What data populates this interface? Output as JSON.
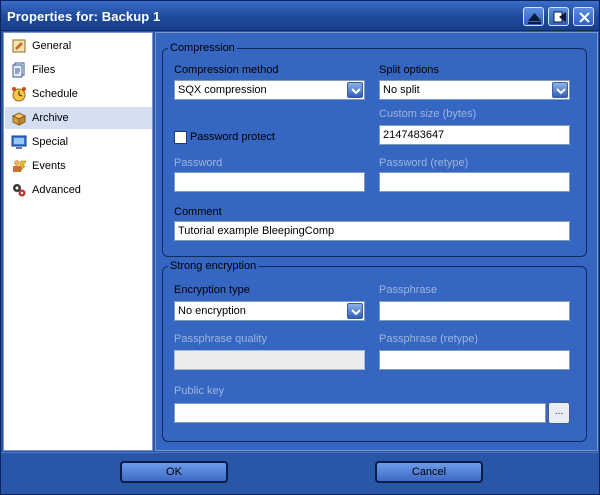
{
  "window": {
    "title": "Properties for: Backup 1"
  },
  "titlebar_buttons": [
    {
      "icon": "triangle-up-icon"
    },
    {
      "icon": "pin-icon"
    },
    {
      "icon": "close-icon"
    }
  ],
  "sidebar": {
    "selected": "Archive",
    "items": [
      {
        "label": "General",
        "icon": "general-icon"
      },
      {
        "label": "Files",
        "icon": "files-icon"
      },
      {
        "label": "Schedule",
        "icon": "schedule-icon"
      },
      {
        "label": "Archive",
        "icon": "archive-icon"
      },
      {
        "label": "Special",
        "icon": "special-icon"
      },
      {
        "label": "Events",
        "icon": "events-icon"
      },
      {
        "label": "Advanced",
        "icon": "advanced-icon"
      }
    ]
  },
  "compression": {
    "legend": "Compression",
    "method_label": "Compression method",
    "method_value": "SQX compression",
    "split_label": "Split options",
    "split_value": "No split",
    "custom_size_label": "Custom size (bytes)",
    "custom_size_value": "2147483647",
    "password_protect_label": "Password protect",
    "password_protect_checked": false,
    "password_label": "Password",
    "password_value": "",
    "password_retype_label": "Password (retype)",
    "password_retype_value": "",
    "comment_label": "Comment",
    "comment_value": "Tutorial example BleepingComp"
  },
  "encryption": {
    "legend": "Strong encryption",
    "type_label": "Encryption type",
    "type_value": "No encryption",
    "passphrase_label": "Passphrase",
    "passphrase_value": "",
    "quality_label": "Passphrase quality",
    "passphrase_retype_label": "Passphrase (retype)",
    "passphrase_retype_value": "",
    "public_key_label": "Public key",
    "public_key_value": "",
    "browse_label": "..."
  },
  "buttons": {
    "ok": "OK",
    "cancel": "Cancel"
  }
}
